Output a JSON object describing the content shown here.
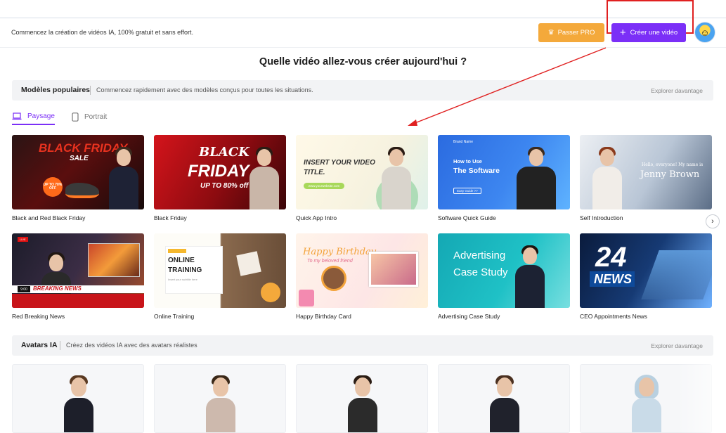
{
  "header": {
    "tagline": "Commencez la création de vidéos IA, 100% gratuit et sans effort.",
    "pro_label": "Passer PRO",
    "create_label": "Créer une vidéo"
  },
  "headline": "Quelle vidéo allez-vous créer aujourd'hui ?",
  "popular": {
    "title": "Modèles populaires",
    "description": "Commencez rapidement avec des modèles conçus pour toutes les situations.",
    "more": "Explorer davantage"
  },
  "tabs": [
    {
      "label": "Paysage",
      "active": true
    },
    {
      "label": "Portrait",
      "active": false
    }
  ],
  "templates": [
    {
      "caption": "Black and Red Black Friday",
      "art": [
        "BLACK FRIDAY",
        "SALE",
        "UP TO 70% OFF"
      ]
    },
    {
      "caption": "Black Friday",
      "art": [
        "BLACK",
        "FRIDAY",
        "UP TO 80% off"
      ]
    },
    {
      "caption": "Quick App Intro",
      "art": [
        "INSERT YOUR VIDEO TITLE.",
        "www.yourwebsite.com"
      ]
    },
    {
      "caption": "Software Quick Guide",
      "art": [
        "Brand Name",
        "How to Use",
        "The Software",
        "Easy Guide >>"
      ]
    },
    {
      "caption": "Self Introduction",
      "art": [
        "Hello, everyone! My name is",
        "Jenny Brown"
      ]
    },
    {
      "caption": "Red Breaking News",
      "art": [
        "LIVE",
        "BREAKING NEWS",
        "9:00"
      ]
    },
    {
      "caption": "Online Training",
      "art": [
        "ONLINE",
        "TRAINING",
        "Insert your subtitle here"
      ]
    },
    {
      "caption": "Happy Birthday Card",
      "art": [
        "Happy Birthday",
        "To my beloved friend"
      ]
    },
    {
      "caption": "Advertising Case Study",
      "art": [
        "Advertising",
        "Case Study"
      ]
    },
    {
      "caption": "CEO Appointments News",
      "art": [
        "24",
        "NEWS"
      ]
    }
  ],
  "avatars_section": {
    "title": "Avatars IA",
    "description": "Créez des vidéos IA avec des avatars réalistes",
    "more": "Explorer davantage"
  },
  "colors": {
    "primary": "#7b2ff7",
    "pro": "#f4a93b",
    "highlight": "#e02020"
  },
  "icons": [
    "crown-icon",
    "plus-icon",
    "laptop-icon",
    "phone-icon",
    "chevron-right-icon"
  ]
}
